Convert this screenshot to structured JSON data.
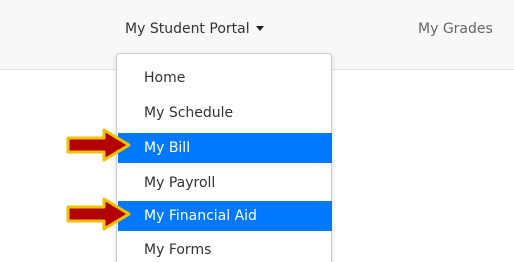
{
  "navbar": {
    "portal_label": "My Student Portal",
    "grades_label": "My Grades"
  },
  "dropdown": {
    "items": [
      {
        "label": "Home",
        "highlighted": false
      },
      {
        "label": "My Schedule",
        "highlighted": false
      },
      {
        "label": "My Bill",
        "highlighted": true
      },
      {
        "label": "My Payroll",
        "highlighted": false
      },
      {
        "label": "My Financial Aid",
        "highlighted": true
      },
      {
        "label": "My Forms",
        "highlighted": false
      }
    ]
  },
  "colors": {
    "highlight": "#0078ff",
    "arrow_fill": "#b30000",
    "arrow_outline": "#f2c200"
  }
}
